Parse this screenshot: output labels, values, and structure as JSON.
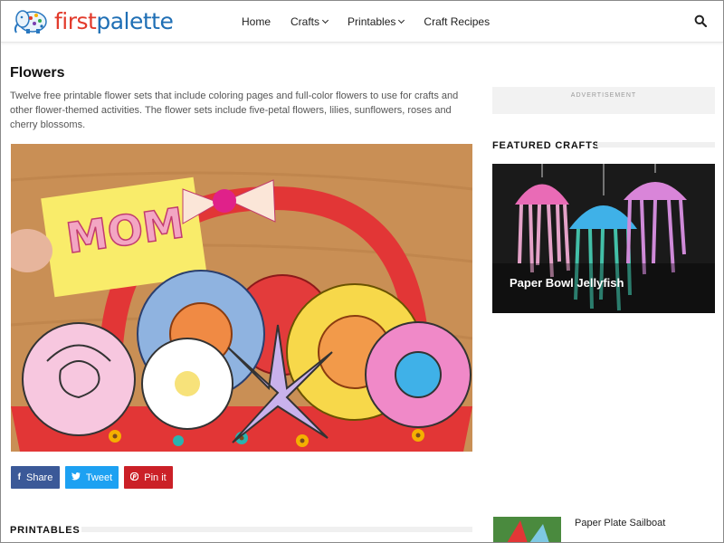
{
  "logo": {
    "text_first": "first",
    "text_second": "palette"
  },
  "nav": {
    "items": [
      {
        "label": "Home",
        "has_dropdown": false
      },
      {
        "label": "Crafts",
        "has_dropdown": true
      },
      {
        "label": "Printables",
        "has_dropdown": true
      },
      {
        "label": "Craft Recipes",
        "has_dropdown": false
      }
    ],
    "search_icon": "search-icon"
  },
  "main": {
    "title": "Flowers",
    "intro": "Twelve free printable flower sets that include coloring pages and full-color flowers to use for crafts and other flower-themed activities. The flower sets include five-petal flowers, lilies, sunflowers, roses and cherry blossoms.",
    "hero_letters": "MOM",
    "share": [
      {
        "label": "Share",
        "icon": "facebook-icon",
        "color": "#3b5998"
      },
      {
        "label": "Tweet",
        "icon": "twitter-icon",
        "color": "#1da1f2"
      },
      {
        "label": "Pin it",
        "icon": "pinterest-icon",
        "color": "#cb2027"
      }
    ],
    "section_heading": "PRINTABLES"
  },
  "sidebar": {
    "ad_label": "ADVERTISEMENT",
    "featured_heading": "FEATURED CRAFTS",
    "featured_title": "Paper Bowl Jellyfish",
    "related_title": "Paper Plate Sailboat"
  },
  "colors": {
    "logo_first": "#e23a2b",
    "logo_second": "#1f6fb5",
    "facebook": "#3b5998",
    "twitter": "#1da1f2",
    "pinterest": "#cb2027"
  }
}
